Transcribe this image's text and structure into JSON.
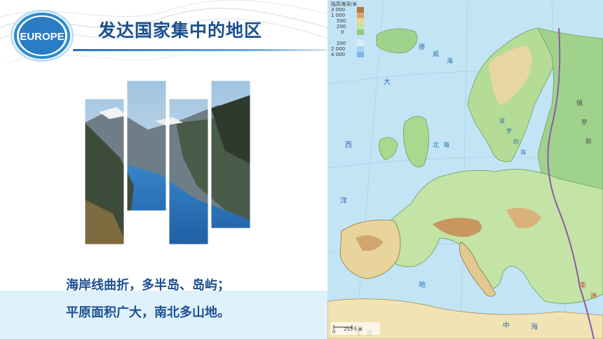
{
  "badge": {
    "text": "EUROPE"
  },
  "title": "发达国家集中的地区",
  "captions": [
    "海岸线曲折，多半岛、岛屿；",
    "平原面积广大，南北多山地。"
  ],
  "map": {
    "legend_title": "陆高海深/米",
    "legend_values": [
      "3 000",
      "1 000",
      "500",
      "200",
      "0",
      "200",
      "2 000",
      "4 000"
    ],
    "scale_label": "255千米",
    "scale_zero": "0",
    "labels": [
      "大",
      "西",
      "洋",
      "北",
      "海",
      "挪",
      "威",
      "海",
      "地",
      "中",
      "海",
      "亚",
      "洲",
      "非",
      "洲",
      "波",
      "罗",
      "的",
      "海",
      "俄",
      "罗",
      "斯"
    ]
  },
  "colors": {
    "title": "#1a4f8e",
    "caption": "#1d4f91",
    "band": "#dff1fb",
    "sea": "#b9dff3"
  }
}
